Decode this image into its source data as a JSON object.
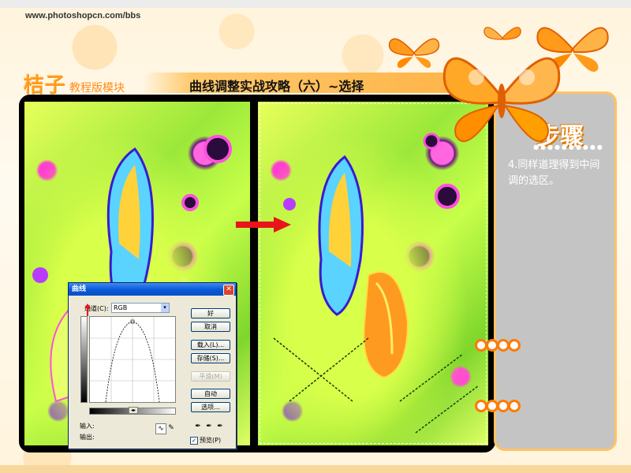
{
  "header": {
    "site_url": "www.photoshopcn.com/bbs",
    "brand_main": "桔子",
    "brand_sub": "教程版模块",
    "page_title": "曲线调整实战攻略（六）~选择"
  },
  "side_panel": {
    "heading": "步骤",
    "dots": "●●●●●●●●●●",
    "step_text": "4.同样道理得到中间调的选区。"
  },
  "curves_dialog": {
    "title": "曲线",
    "close_glyph": "✕",
    "channel_label": "通道(C):",
    "channel_value": "RGB",
    "dropdown_glyph": "▾",
    "ok_label": "好",
    "cancel_label": "取消",
    "load_label": "载入(L)...",
    "save_label": "存储(S)...",
    "smooth_label": "平滑(M)",
    "auto_label": "自动",
    "options_label": "选项...",
    "input_label": "输入:",
    "output_label": "输出:",
    "preview_label": "预览(P)",
    "preview_checked": true,
    "check_glyph": "✓"
  },
  "colors": {
    "accent_orange": "#ff9a1a",
    "panel_gray": "#c4c4c4",
    "arrow_red": "#e8141a"
  },
  "icons": {
    "butterfly": "butterfly-icon",
    "red_arrow": "arrow-right-icon",
    "eyedropper": "eyedropper-icon"
  }
}
